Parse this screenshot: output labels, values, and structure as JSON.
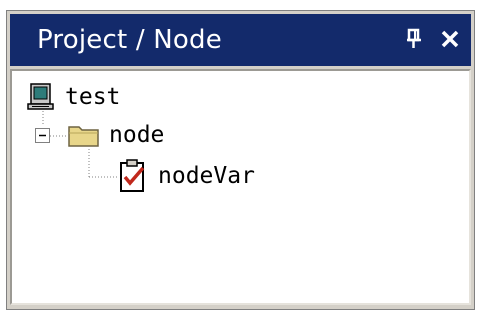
{
  "panel": {
    "title": "Project / Node",
    "buttons": [
      {
        "name": "pin",
        "glyph": "Θ"
      },
      {
        "name": "close",
        "glyph": "✕"
      }
    ]
  },
  "tree": {
    "root": {
      "label": "test",
      "icon": "computer-icon"
    },
    "folder": {
      "label": "node",
      "icon": "folder-icon",
      "expanded": true,
      "toggle": "−"
    },
    "leaf": {
      "label": "nodeVar",
      "icon": "clipboard-check-icon"
    }
  },
  "colors": {
    "titlebar": "#132a6b",
    "panel_bg": "#d4d0c8",
    "content_bg": "#ffffff",
    "folder": "#e8d68a",
    "check": "#c0281c"
  }
}
